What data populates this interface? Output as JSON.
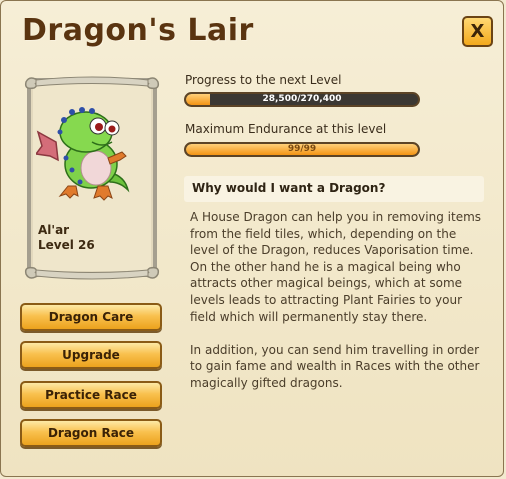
{
  "window": {
    "title": "Dragon's Lair",
    "close_label": "X"
  },
  "dragon": {
    "name": "Al'ar",
    "level": "Level 26"
  },
  "actions": [
    {
      "label": "Dragon Care"
    },
    {
      "label": "Upgrade"
    },
    {
      "label": "Practice Race"
    },
    {
      "label": "Dragon Race"
    }
  ],
  "progress": {
    "label": "Progress to the next Level",
    "value_text": "28,500/270,400",
    "fraction": 0.105
  },
  "endurance": {
    "label": "Maximum Endurance at this level",
    "value_text": "99/99",
    "fraction": 1.0
  },
  "info": {
    "heading": "Why would I want a Dragon?",
    "paragraph1": "A House Dragon can help you in removing items from the field tiles, which, depending on the level of the Dragon, reduces Vaporisation time. On the other hand he is a magical being who attracts other magical beings, which at some levels leads to attracting Plant Fairies to your field which will permanently stay there.",
    "paragraph2": "In addition, you can send him travelling in order to gain fame and wealth in Races with the other magically gifted dragons."
  },
  "colors": {
    "title": "#5a3410",
    "button_gold": "#f9c14f",
    "bar_fill": "#f39414"
  }
}
